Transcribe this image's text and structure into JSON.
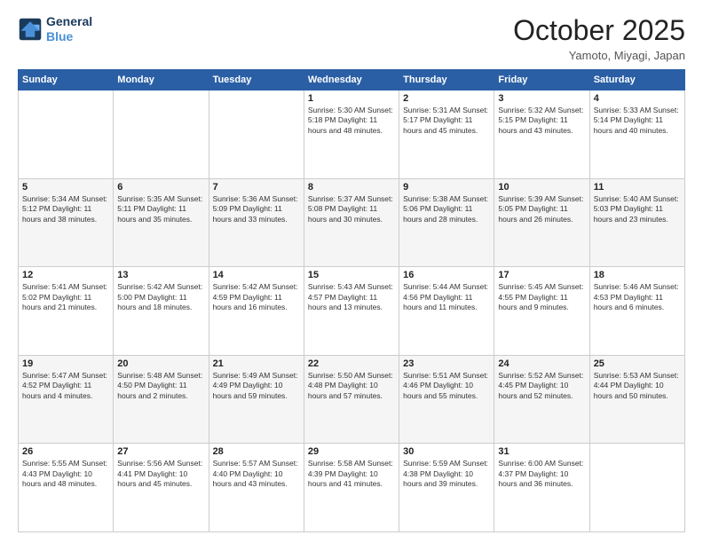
{
  "logo": {
    "line1": "General",
    "line2": "Blue"
  },
  "title": "October 2025",
  "location": "Yamoto, Miyagi, Japan",
  "weekdays": [
    "Sunday",
    "Monday",
    "Tuesday",
    "Wednesday",
    "Thursday",
    "Friday",
    "Saturday"
  ],
  "weeks": [
    [
      {
        "day": "",
        "info": ""
      },
      {
        "day": "",
        "info": ""
      },
      {
        "day": "",
        "info": ""
      },
      {
        "day": "1",
        "info": "Sunrise: 5:30 AM\nSunset: 5:18 PM\nDaylight: 11 hours\nand 48 minutes."
      },
      {
        "day": "2",
        "info": "Sunrise: 5:31 AM\nSunset: 5:17 PM\nDaylight: 11 hours\nand 45 minutes."
      },
      {
        "day": "3",
        "info": "Sunrise: 5:32 AM\nSunset: 5:15 PM\nDaylight: 11 hours\nand 43 minutes."
      },
      {
        "day": "4",
        "info": "Sunrise: 5:33 AM\nSunset: 5:14 PM\nDaylight: 11 hours\nand 40 minutes."
      }
    ],
    [
      {
        "day": "5",
        "info": "Sunrise: 5:34 AM\nSunset: 5:12 PM\nDaylight: 11 hours\nand 38 minutes."
      },
      {
        "day": "6",
        "info": "Sunrise: 5:35 AM\nSunset: 5:11 PM\nDaylight: 11 hours\nand 35 minutes."
      },
      {
        "day": "7",
        "info": "Sunrise: 5:36 AM\nSunset: 5:09 PM\nDaylight: 11 hours\nand 33 minutes."
      },
      {
        "day": "8",
        "info": "Sunrise: 5:37 AM\nSunset: 5:08 PM\nDaylight: 11 hours\nand 30 minutes."
      },
      {
        "day": "9",
        "info": "Sunrise: 5:38 AM\nSunset: 5:06 PM\nDaylight: 11 hours\nand 28 minutes."
      },
      {
        "day": "10",
        "info": "Sunrise: 5:39 AM\nSunset: 5:05 PM\nDaylight: 11 hours\nand 26 minutes."
      },
      {
        "day": "11",
        "info": "Sunrise: 5:40 AM\nSunset: 5:03 PM\nDaylight: 11 hours\nand 23 minutes."
      }
    ],
    [
      {
        "day": "12",
        "info": "Sunrise: 5:41 AM\nSunset: 5:02 PM\nDaylight: 11 hours\nand 21 minutes."
      },
      {
        "day": "13",
        "info": "Sunrise: 5:42 AM\nSunset: 5:00 PM\nDaylight: 11 hours\nand 18 minutes."
      },
      {
        "day": "14",
        "info": "Sunrise: 5:42 AM\nSunset: 4:59 PM\nDaylight: 11 hours\nand 16 minutes."
      },
      {
        "day": "15",
        "info": "Sunrise: 5:43 AM\nSunset: 4:57 PM\nDaylight: 11 hours\nand 13 minutes."
      },
      {
        "day": "16",
        "info": "Sunrise: 5:44 AM\nSunset: 4:56 PM\nDaylight: 11 hours\nand 11 minutes."
      },
      {
        "day": "17",
        "info": "Sunrise: 5:45 AM\nSunset: 4:55 PM\nDaylight: 11 hours\nand 9 minutes."
      },
      {
        "day": "18",
        "info": "Sunrise: 5:46 AM\nSunset: 4:53 PM\nDaylight: 11 hours\nand 6 minutes."
      }
    ],
    [
      {
        "day": "19",
        "info": "Sunrise: 5:47 AM\nSunset: 4:52 PM\nDaylight: 11 hours\nand 4 minutes."
      },
      {
        "day": "20",
        "info": "Sunrise: 5:48 AM\nSunset: 4:50 PM\nDaylight: 11 hours\nand 2 minutes."
      },
      {
        "day": "21",
        "info": "Sunrise: 5:49 AM\nSunset: 4:49 PM\nDaylight: 10 hours\nand 59 minutes."
      },
      {
        "day": "22",
        "info": "Sunrise: 5:50 AM\nSunset: 4:48 PM\nDaylight: 10 hours\nand 57 minutes."
      },
      {
        "day": "23",
        "info": "Sunrise: 5:51 AM\nSunset: 4:46 PM\nDaylight: 10 hours\nand 55 minutes."
      },
      {
        "day": "24",
        "info": "Sunrise: 5:52 AM\nSunset: 4:45 PM\nDaylight: 10 hours\nand 52 minutes."
      },
      {
        "day": "25",
        "info": "Sunrise: 5:53 AM\nSunset: 4:44 PM\nDaylight: 10 hours\nand 50 minutes."
      }
    ],
    [
      {
        "day": "26",
        "info": "Sunrise: 5:55 AM\nSunset: 4:43 PM\nDaylight: 10 hours\nand 48 minutes."
      },
      {
        "day": "27",
        "info": "Sunrise: 5:56 AM\nSunset: 4:41 PM\nDaylight: 10 hours\nand 45 minutes."
      },
      {
        "day": "28",
        "info": "Sunrise: 5:57 AM\nSunset: 4:40 PM\nDaylight: 10 hours\nand 43 minutes."
      },
      {
        "day": "29",
        "info": "Sunrise: 5:58 AM\nSunset: 4:39 PM\nDaylight: 10 hours\nand 41 minutes."
      },
      {
        "day": "30",
        "info": "Sunrise: 5:59 AM\nSunset: 4:38 PM\nDaylight: 10 hours\nand 39 minutes."
      },
      {
        "day": "31",
        "info": "Sunrise: 6:00 AM\nSunset: 4:37 PM\nDaylight: 10 hours\nand 36 minutes."
      },
      {
        "day": "",
        "info": ""
      }
    ]
  ]
}
